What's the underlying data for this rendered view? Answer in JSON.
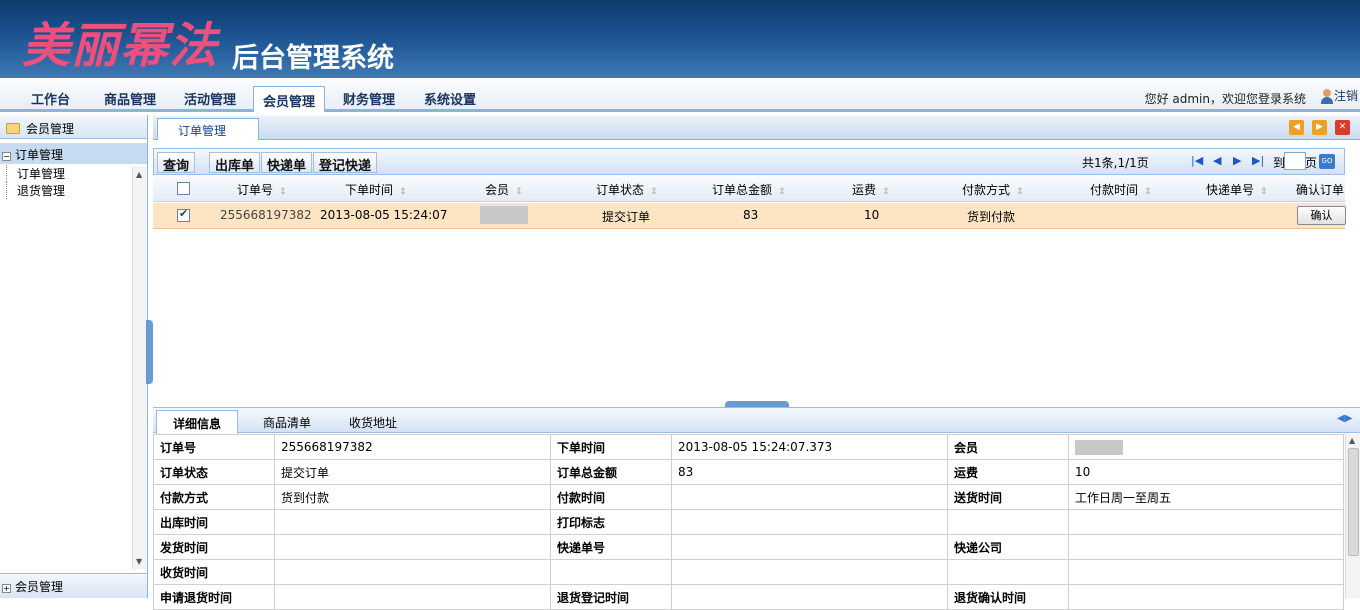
{
  "header": {
    "logo": "美丽幂法",
    "subtitle": "后台管理系统"
  },
  "nav": {
    "items": [
      "工作台",
      "商品管理",
      "活动管理",
      "会员管理",
      "财务管理",
      "系统设置"
    ],
    "active": "会员管理",
    "greeting": "您好 admin，欢迎您登录系统",
    "logout": "注销"
  },
  "sidebar": {
    "title": "会员管理",
    "group": "订单管理",
    "items": [
      "订单管理",
      "退货管理"
    ],
    "footer": "会员管理"
  },
  "main": {
    "tab": "订单管理",
    "toolbar": {
      "query": "查询",
      "outbound": "出库单",
      "express": "快递单",
      "register": "登记快递"
    },
    "pager": {
      "summary": "共1条,1/1页",
      "goto": "到",
      "page_unit": "页",
      "go": "GO"
    },
    "columns": [
      "订单号",
      "下单时间",
      "会员",
      "订单状态",
      "订单总金额",
      "运费",
      "付款方式",
      "付款时间",
      "快递单号",
      "确认订单"
    ],
    "rows": [
      {
        "order_no": "255668197382",
        "order_time": "2013-08-05 15:24:07",
        "status": "提交订单",
        "total": "83",
        "freight": "10",
        "pay_method": "货到付款",
        "confirm": "确认",
        "checked": true
      }
    ]
  },
  "detail": {
    "tabs": [
      "详细信息",
      "商品清单",
      "收货地址"
    ],
    "labels": {
      "order_no": "订单号",
      "order_time": "下单时间",
      "member": "会员",
      "status": "订单状态",
      "total": "订单总金额",
      "freight": "运费",
      "pay_method": "付款方式",
      "pay_time": "付款时间",
      "delivery_time": "送货时间",
      "outbound_time": "出库时间",
      "print_flag": "打印标志",
      "ship_time": "发货时间",
      "express_no": "快递单号",
      "express_company": "快递公司",
      "receive_time": "收货时间",
      "return_apply_time": "申请退货时间",
      "return_register_time": "退货登记时间",
      "return_confirm_time": "退货确认时间"
    },
    "values": {
      "order_no": "255668197382",
      "order_time": "2013-08-05 15:24:07.373",
      "status": "提交订单",
      "total": "83",
      "freight": "10",
      "pay_method": "货到付款",
      "delivery_time": "工作日周一至周五"
    }
  },
  "colors": {
    "banner": "#1c5290",
    "logo": "#ee4f7d",
    "row_selected": "#fde5c4",
    "accent": "#8eb3d9"
  }
}
